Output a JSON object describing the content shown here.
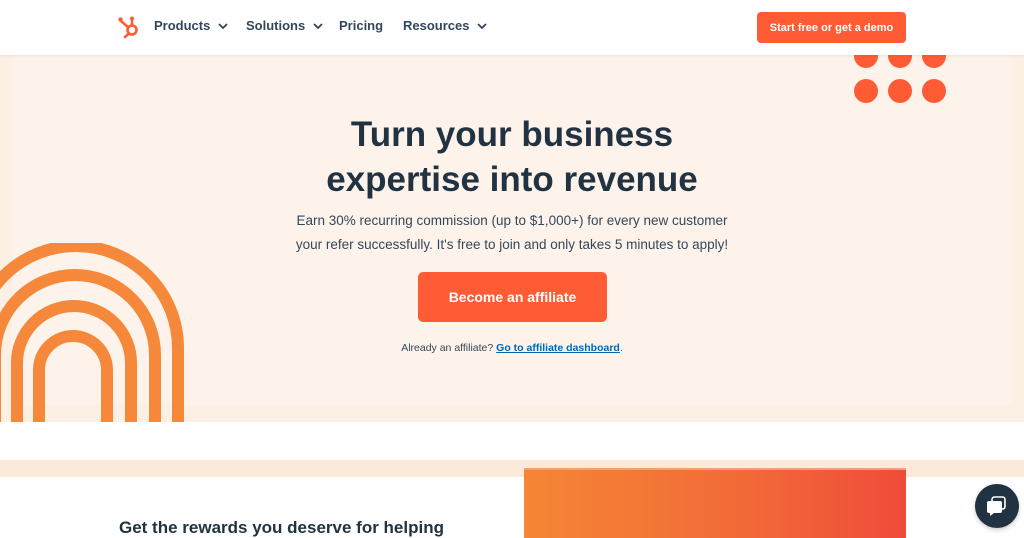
{
  "navbar": {
    "logo": "hubspot-sprocket-icon",
    "items": [
      {
        "label": "Products",
        "has_dropdown": true
      },
      {
        "label": "Solutions",
        "has_dropdown": true
      },
      {
        "label": "Pricing",
        "has_dropdown": false
      },
      {
        "label": "Resources",
        "has_dropdown": true
      }
    ],
    "cta_label": "Start free or get a demo"
  },
  "hero": {
    "headline_line1": "Turn your business",
    "headline_line2": "expertise into revenue",
    "subtext_line1": "Earn 30% recurring commission (up to $1,000+) for every new customer",
    "subtext_line2": "your refer successfully. It's free to join and only takes 5 minutes to apply!",
    "cta_label": "Become an affiliate",
    "already_text": "Already an affiliate?",
    "dashboard_link": "Go to affiliate dashboard",
    "dashboard_suffix": "."
  },
  "section2": {
    "heading": "Get the rewards you deserve for helping"
  },
  "colors": {
    "brand_orange": "#ff5c35",
    "arch_orange": "#f5883a",
    "dark_navy": "#213343",
    "hero_bg": "#fdf3ea",
    "link_blue": "#0068b1"
  },
  "chat_widget": {
    "icon": "chat-bubble-icon"
  }
}
